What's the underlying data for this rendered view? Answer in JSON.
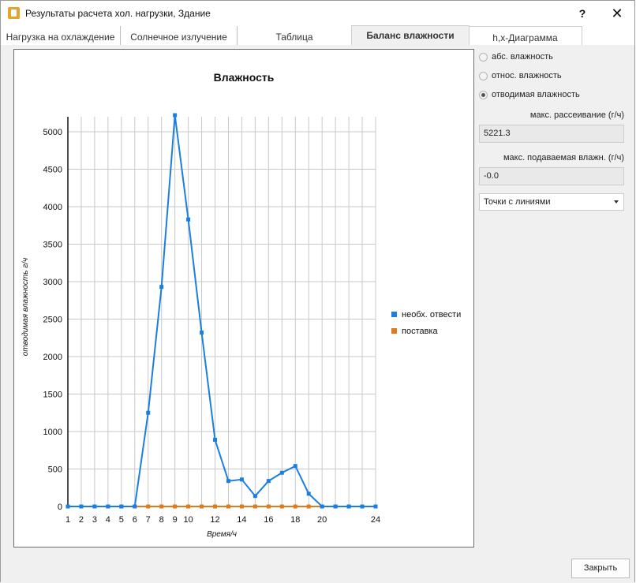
{
  "window": {
    "title": "Результаты расчета хол. нагрузки, Здание",
    "help_label": "?",
    "close_label": "✕"
  },
  "tabs": [
    {
      "label": "Нагрузка на охлаждение"
    },
    {
      "label": "Солнечное излучение"
    },
    {
      "label": "Таблица"
    },
    {
      "label": "Баланс влажности"
    },
    {
      "label": "h,x-Диаграмма"
    }
  ],
  "side_panel": {
    "radio_abs": "абс. влажность",
    "radio_rel": "относ. влажность",
    "radio_removed": "отводимая влажность",
    "selected_radio": "отводимая влажность",
    "max_dissipation_label": "макс. рассеивание (г/ч)",
    "max_dissipation_value": "5221.3",
    "max_supply_label": "макс. подаваемая влажн. (г/ч)",
    "max_supply_value": "-0.0",
    "plot_style_value": "Точки с линиями"
  },
  "footer": {
    "close_button": "Закрыть"
  },
  "chart_data": {
    "type": "line",
    "title": "Влажность",
    "xlabel": "Время/ч",
    "ylabel": "отводимая влажность г/ч",
    "x": [
      1,
      2,
      3,
      4,
      5,
      6,
      7,
      8,
      9,
      10,
      11,
      12,
      13,
      14,
      15,
      16,
      17,
      18,
      19,
      20,
      21,
      22,
      23,
      24
    ],
    "xlim": [
      1,
      24
    ],
    "ylim": [
      0,
      5200
    ],
    "x_ticks": [
      1,
      2,
      3,
      4,
      5,
      6,
      7,
      8,
      9,
      10,
      12,
      14,
      16,
      18,
      20,
      24
    ],
    "y_ticks": [
      0,
      500,
      1000,
      1500,
      2000,
      2500,
      3000,
      3500,
      4000,
      4500,
      5000
    ],
    "grid": true,
    "legend_position": "right",
    "series": [
      {
        "name": "необх. отвести",
        "color": "#1a7fe0",
        "marker_color": "#1a7fe0",
        "values": [
          0,
          0,
          0,
          0,
          0,
          0,
          1250,
          2930,
          5221,
          3830,
          2320,
          890,
          340,
          360,
          140,
          340,
          450,
          540,
          170,
          0,
          0,
          0,
          0,
          0
        ]
      },
      {
        "name": "поставка",
        "color": "#e07a1a",
        "marker_color": "#e07a1a",
        "values": [
          0,
          0,
          0,
          0,
          0,
          0,
          0,
          0,
          0,
          0,
          0,
          0,
          0,
          0,
          0,
          0,
          0,
          0,
          0,
          0,
          0,
          0,
          0,
          0
        ]
      }
    ]
  }
}
